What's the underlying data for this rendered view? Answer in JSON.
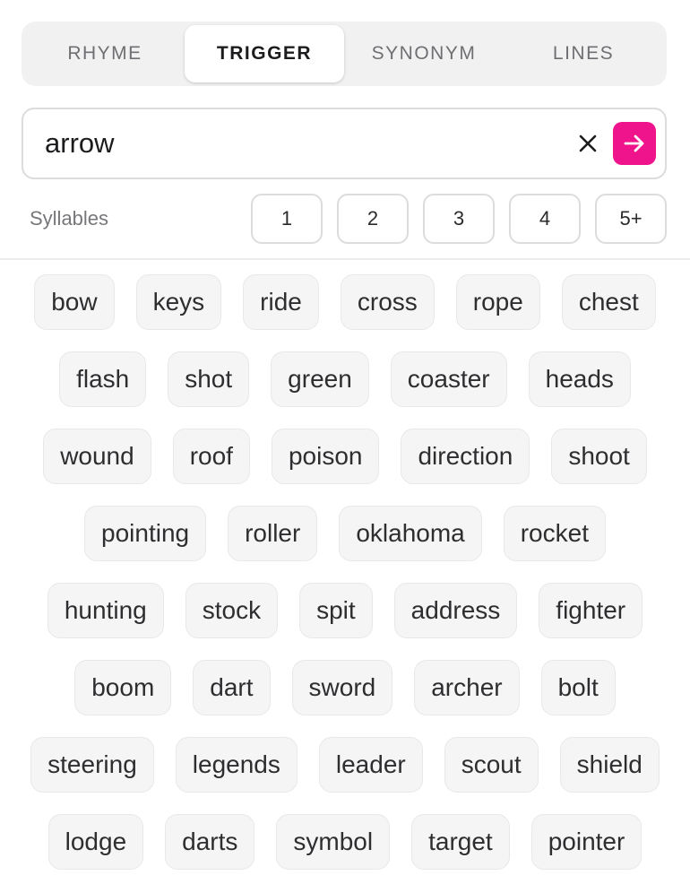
{
  "tabs": [
    {
      "label": "RHYME",
      "active": false
    },
    {
      "label": "TRIGGER",
      "active": true
    },
    {
      "label": "SYNONYM",
      "active": false
    },
    {
      "label": "LINES",
      "active": false
    }
  ],
  "search": {
    "value": "arrow",
    "accent": "#f0148c"
  },
  "syllables": {
    "label": "Syllables",
    "options": [
      "1",
      "2",
      "3",
      "4",
      "5+"
    ]
  },
  "words": [
    [
      "bow",
      "keys",
      "ride",
      "cross",
      "rope",
      "chest"
    ],
    [
      "flash",
      "shot",
      "green",
      "coaster",
      "heads"
    ],
    [
      "wound",
      "roof",
      "poison",
      "direction",
      "shoot"
    ],
    [
      "pointing",
      "roller",
      "oklahoma",
      "rocket"
    ],
    [
      "hunting",
      "stock",
      "spit",
      "address",
      "fighter"
    ],
    [
      "boom",
      "dart",
      "sword",
      "archer",
      "bolt"
    ],
    [
      "steering",
      "legends",
      "leader",
      "scout",
      "shield"
    ],
    [
      "lodge",
      "darts",
      "symbol",
      "target",
      "pointer"
    ]
  ]
}
